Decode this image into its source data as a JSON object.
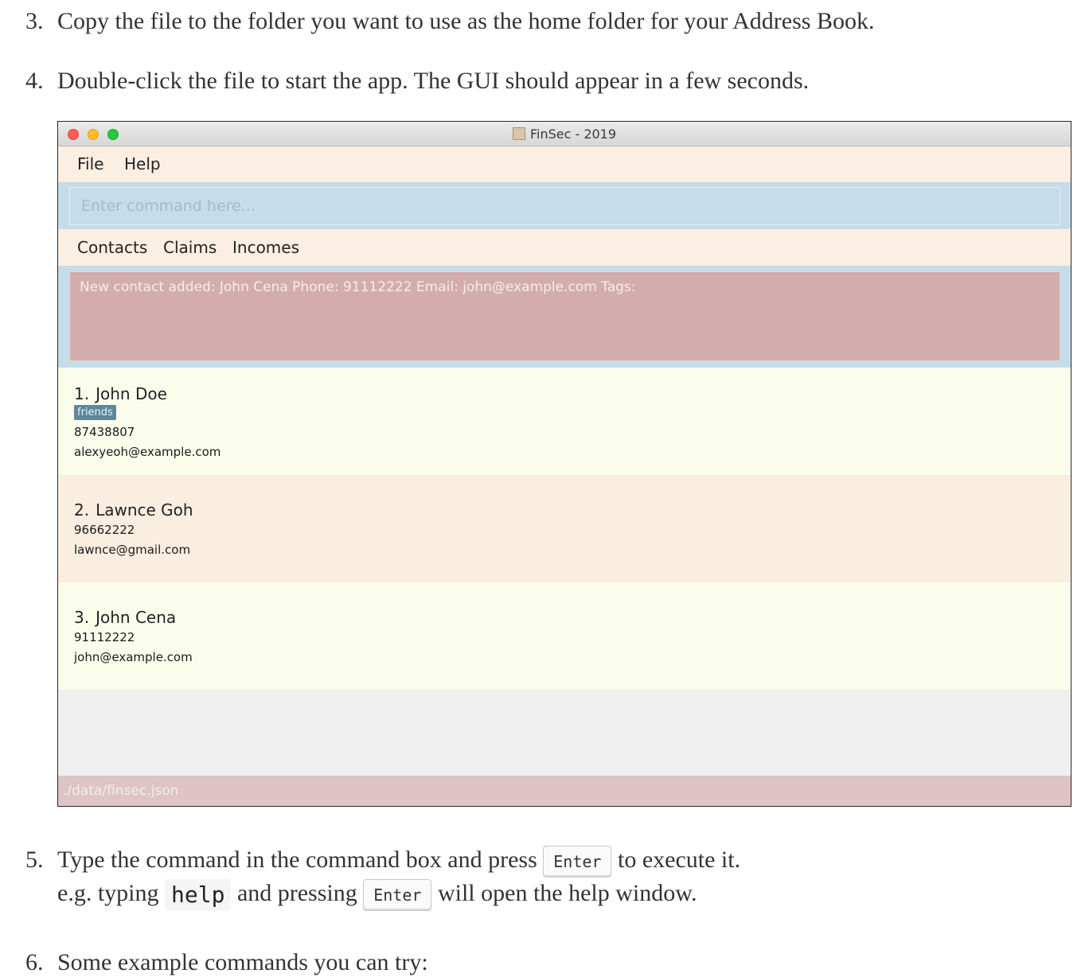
{
  "steps": {
    "step3": {
      "number": "3.",
      "text": "Copy the file to the folder you want to use as the home folder for your Address Book."
    },
    "step4": {
      "number": "4.",
      "text": "Double-click the file to start the app. The GUI should appear in a few seconds."
    },
    "step5": {
      "number": "5.",
      "line1_before": "Type the command in the command box and press",
      "line1_key": "Enter",
      "line1_after": "to execute it.",
      "line2_before": "e.g. typing",
      "line2_code": "help",
      "line2_middle": "and pressing",
      "line2_key": "Enter",
      "line2_after": "will open the help window."
    },
    "step6": {
      "number": "6.",
      "text": "Some example commands you can try:"
    }
  },
  "app": {
    "window_title": "FinSec - 2019",
    "menu": {
      "file": "File",
      "help": "Help"
    },
    "command_box": {
      "placeholder": "Enter command here...",
      "value": ""
    },
    "tabs": {
      "contacts": "Contacts",
      "claims": "Claims",
      "incomes": "Incomes"
    },
    "result_message": "New contact added: John Cena Phone: 91112222 Email: john@example.com Tags:",
    "contacts": [
      {
        "index": "1.",
        "name": "John Doe",
        "tags": [
          "friends"
        ],
        "phone": "87438807",
        "email": "alexyeoh@example.com"
      },
      {
        "index": "2.",
        "name": "Lawnce Goh",
        "tags": [],
        "phone": "96662222",
        "email": "lawnce@gmail.com"
      },
      {
        "index": "3.",
        "name": "John Cena",
        "tags": [],
        "phone": "91112222",
        "email": "john@example.com"
      }
    ],
    "status_bar_path": "./data/finsec.json"
  },
  "colors": {
    "menubar_bg": "#fbeee2",
    "command_area_bg": "#c5dcea",
    "result_box_bg": "#d3adae",
    "card_light_bg": "#fafdec",
    "card_alt_bg": "#faeee0",
    "tag_bg": "#5d879a",
    "status_bar_bg": "#dec4c4"
  },
  "icons": {
    "window_close": "red-traffic-light-icon",
    "window_minimize": "yellow-traffic-light-icon",
    "window_zoom": "green-traffic-light-icon",
    "app_title_icon": "app-document-icon"
  }
}
